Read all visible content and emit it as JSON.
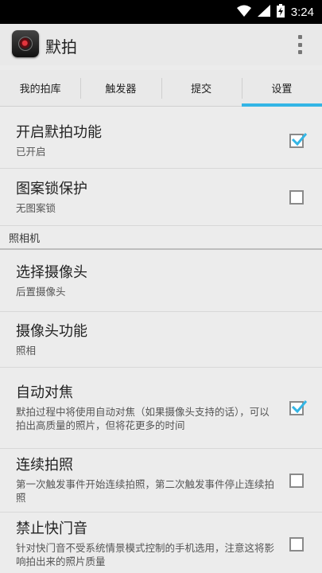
{
  "status_bar": {
    "time": "3:24"
  },
  "app_bar": {
    "title": "默拍",
    "icon": "camera-app-icon",
    "menu_icon": "overflow-menu-icon"
  },
  "tabs": [
    {
      "label": "我的拍库",
      "active": false
    },
    {
      "label": "触发器",
      "active": false
    },
    {
      "label": "提交",
      "active": false
    },
    {
      "label": "设置",
      "active": true
    }
  ],
  "accent_color": "#33b5e5",
  "prefs": [
    {
      "title": "开启默拍功能",
      "summary": "已开启",
      "checked": true
    },
    {
      "title": "图案锁保护",
      "summary": "无图案锁",
      "checked": false
    }
  ],
  "camera_category": {
    "label": "照相机"
  },
  "camera_prefs": [
    {
      "title": "选择摄像头",
      "summary": "后置摄像头"
    },
    {
      "title": "摄像头功能",
      "summary": "照相"
    },
    {
      "title": "自动对焦",
      "summary": "默拍过程中将使用自动对焦（如果摄像头支持的话），可以拍出高质量的照片，但将花更多的时间",
      "checked": true
    },
    {
      "title": "连续拍照",
      "summary": "第一次触发事件开始连续拍照，第二次触发事件停止连续拍照",
      "checked": false
    },
    {
      "title": "禁止快门音",
      "summary": "针对快门音不受系统情景模式控制的手机选用，注意这将影响拍出来的照片质量",
      "checked": false
    }
  ]
}
